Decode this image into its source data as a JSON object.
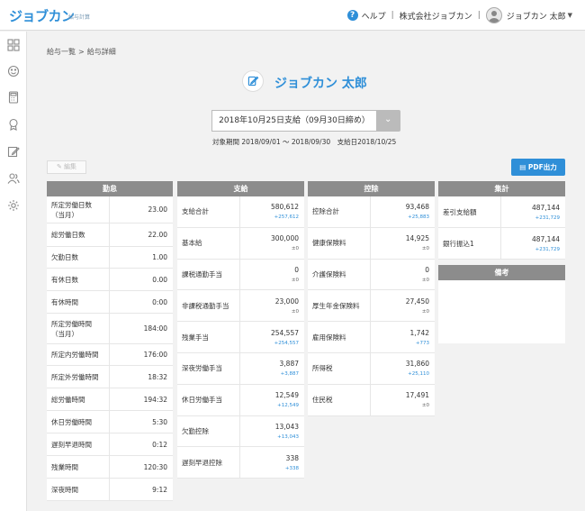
{
  "header": {
    "logo": "ジョブカン",
    "logo_sub": "給与計算",
    "help": "ヘルプ",
    "company": "株式会社ジョブカン",
    "user": "ジョブカン 太郎",
    "separator": "|"
  },
  "breadcrumb": {
    "parent": "給与一覧",
    "sep": ">",
    "current": "給与詳細"
  },
  "employee": {
    "name": "ジョブカン 太郎"
  },
  "payslip": {
    "date": "2018年10月25日支給（09月30日締め）",
    "period": "対象期間 2018/09/01 〜 2018/09/30　支給日2018/10/25"
  },
  "buttons": {
    "edit": "✎ 編集",
    "pdf": "PDF出力"
  },
  "attendance": {
    "title": "勤怠",
    "rows": [
      {
        "label": "所定労働日数（当月）",
        "value": "23.00"
      },
      {
        "label": "総労働日数",
        "value": "22.00"
      },
      {
        "label": "欠勤日数",
        "value": "1.00"
      },
      {
        "label": "有休日数",
        "value": "0.00"
      },
      {
        "label": "有休時間",
        "value": "0:00"
      },
      {
        "label": "所定労働時間（当月）",
        "value": "184:00"
      },
      {
        "label": "所定内労働時間",
        "value": "176:00"
      },
      {
        "label": "所定外労働時間",
        "value": "18:32"
      },
      {
        "label": "総労働時間",
        "value": "194:32"
      },
      {
        "label": "休日労働時間",
        "value": "5:30"
      },
      {
        "label": "遅刻早退時間",
        "value": "0:12"
      },
      {
        "label": "残業時間",
        "value": "120:30"
      },
      {
        "label": "深夜時間",
        "value": "9:12"
      }
    ]
  },
  "payment": {
    "title": "支給",
    "rows": [
      {
        "label": "支給合計",
        "value": "580,612",
        "delta": "+257,612"
      },
      {
        "label": "基本給",
        "value": "300,000",
        "delta": "±0"
      },
      {
        "label": "課税通勤手当",
        "value": "0",
        "delta": "±0"
      },
      {
        "label": "非課税通勤手当",
        "value": "23,000",
        "delta": "±0"
      },
      {
        "label": "残業手当",
        "value": "254,557",
        "delta": "+254,557"
      },
      {
        "label": "深夜労働手当",
        "value": "3,887",
        "delta": "+3,887"
      },
      {
        "label": "休日労働手当",
        "value": "12,549",
        "delta": "+12,549"
      },
      {
        "label": "欠勤控除",
        "value": "13,043",
        "delta": "+13,043"
      },
      {
        "label": "遅刻早退控除",
        "value": "338",
        "delta": "+338"
      }
    ]
  },
  "deduction": {
    "title": "控除",
    "rows": [
      {
        "label": "控除合計",
        "value": "93,468",
        "delta": "+25,883"
      },
      {
        "label": "健康保険料",
        "value": "14,925",
        "delta": "±0"
      },
      {
        "label": "介護保険料",
        "value": "0",
        "delta": "±0"
      },
      {
        "label": "厚生年金保険料",
        "value": "27,450",
        "delta": "±0"
      },
      {
        "label": "雇用保険料",
        "value": "1,742",
        "delta": "+773"
      },
      {
        "label": "所得税",
        "value": "31,860",
        "delta": "+25,110"
      },
      {
        "label": "住民税",
        "value": "17,491",
        "delta": "±0"
      }
    ]
  },
  "totals": {
    "title": "集計",
    "rows": [
      {
        "label": "差引支給額",
        "value": "487,144",
        "delta": "+231,729"
      },
      {
        "label": "銀行振込1",
        "value": "487,144",
        "delta": "+231,729"
      }
    ]
  },
  "notes": {
    "title": "備考"
  },
  "colors": {
    "accent": "#2f8fd8",
    "header_gray": "#8c8c8c"
  }
}
